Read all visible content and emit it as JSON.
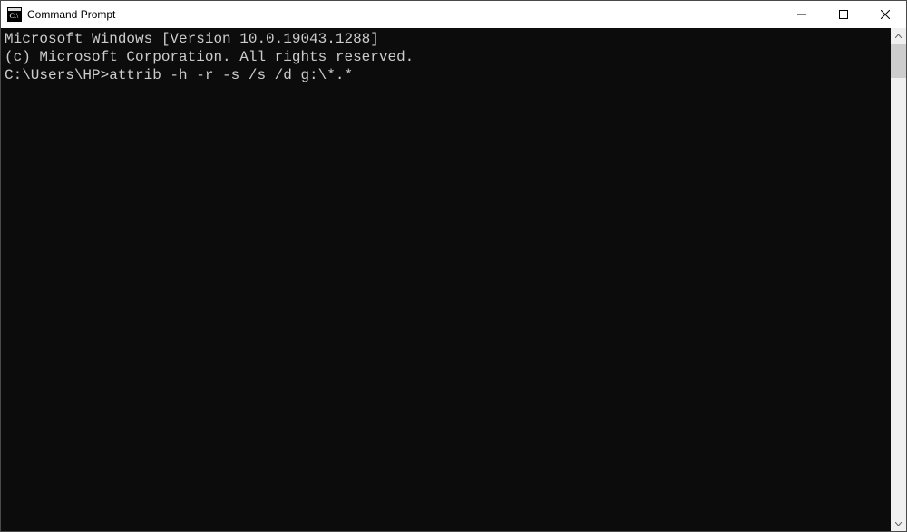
{
  "window": {
    "title": "Command Prompt"
  },
  "console": {
    "line1": "Microsoft Windows [Version 10.0.19043.1288]",
    "line2": "(c) Microsoft Corporation. All rights reserved.",
    "blank": "",
    "prompt": "C:\\Users\\HP>",
    "command": "attrib -h -r -s /s /d g:\\*.*"
  }
}
